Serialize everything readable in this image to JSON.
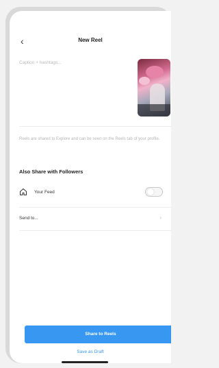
{
  "header": {
    "back_icon": "chevron-left-icon",
    "title": "New Reel"
  },
  "caption": {
    "placeholder": "Caption + hashtags..."
  },
  "info": {
    "text": "Reels are shared to Explore and can be seen on the Reels tab of your profile."
  },
  "share_section": {
    "title": "Also Share with Followers",
    "your_feed": {
      "icon": "home-icon",
      "label": "Your Feed",
      "toggle_on": false
    },
    "send_to": {
      "label": "Send to...",
      "chevron": "chevron-right-icon"
    }
  },
  "actions": {
    "primary_label": "Share to Reels",
    "secondary_label": "Save as Draft"
  },
  "colors": {
    "accent": "#3897f0"
  }
}
